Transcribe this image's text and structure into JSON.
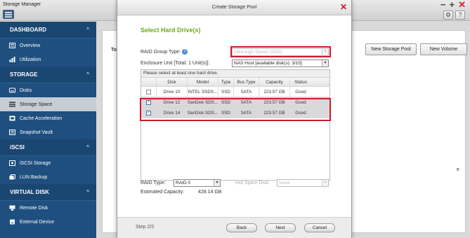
{
  "app": {
    "title": "Storage Manager"
  },
  "sidebar": {
    "sections": [
      {
        "label": "DASHBOARD",
        "items": [
          {
            "label": "Overview",
            "icon": "overview-icon"
          },
          {
            "label": "Utilization",
            "icon": "chart-icon"
          }
        ]
      },
      {
        "label": "STORAGE",
        "items": [
          {
            "label": "Disks",
            "icon": "disk-icon"
          },
          {
            "label": "Storage Space",
            "icon": "list-icon",
            "active": true
          },
          {
            "label": "Cache Acceleration",
            "icon": "cache-icon"
          },
          {
            "label": "Snapshot Vault",
            "icon": "vault-icon"
          }
        ]
      },
      {
        "label": "iSCSI",
        "items": [
          {
            "label": "iSCSI Storage",
            "icon": "iscsi-icon"
          },
          {
            "label": "LUN Backup",
            "icon": "backup-icon"
          }
        ]
      },
      {
        "label": "VIRTUAL DISK",
        "items": [
          {
            "label": "Remote Disk",
            "icon": "remote-disk-icon"
          },
          {
            "label": "External Device",
            "icon": "external-device-icon"
          }
        ]
      }
    ]
  },
  "main": {
    "panel_label": "Tot",
    "right_fragment": "e",
    "new_storage_pool": "New Storage Pool",
    "new_volume": "New Volume"
  },
  "dialog": {
    "title": "Create Storage Pool",
    "heading": "Select Hard Drive(s)",
    "raid_group_label": "RAID Group Type:",
    "raid_group_value": "Ultra-high Speed (SSD)",
    "enclosure_label": "Enclosure Unit [Total: 1 Unit(s)]:",
    "enclosure_value": "NAS Host [available disk(s): 3/15]",
    "table_instruction": "Please select at least one hard drive.",
    "columns": [
      "Disk",
      "Model",
      "Type",
      "Bus Type",
      "Capacity",
      "Status"
    ],
    "rows": [
      {
        "disk": "Drive 10",
        "model": "INTEL SSDS...",
        "type": "SSD",
        "bus": "SATA",
        "capacity": "223.57 GB",
        "status": "Good",
        "checked": false
      },
      {
        "disk": "Drive 12",
        "model": "SanDisk SDS...",
        "type": "SSD",
        "bus": "SATA",
        "capacity": "223.57 GB",
        "status": "Good",
        "checked": true
      },
      {
        "disk": "Drive 14",
        "model": "SanDisk SDS...",
        "type": "SSD",
        "bus": "SATA",
        "capacity": "223.57 GB",
        "status": "Good",
        "checked": true
      }
    ],
    "raid_type_label": "RAID Type:",
    "raid_type_value": "RAID 0",
    "hot_spare_label": "Hot Spare Disk:",
    "hot_spare_value": "None",
    "est_capacity_label": "Estimated Capacity:",
    "est_capacity_value": "428.14 GB",
    "step": "Step 2/3",
    "back": "Back",
    "next": "Next",
    "cancel": "Cancel"
  },
  "colors": {
    "sidebar": "#1e4f7f",
    "heading": "#6bab1a",
    "highlight": "#d0182a",
    "close": "#c81818"
  }
}
